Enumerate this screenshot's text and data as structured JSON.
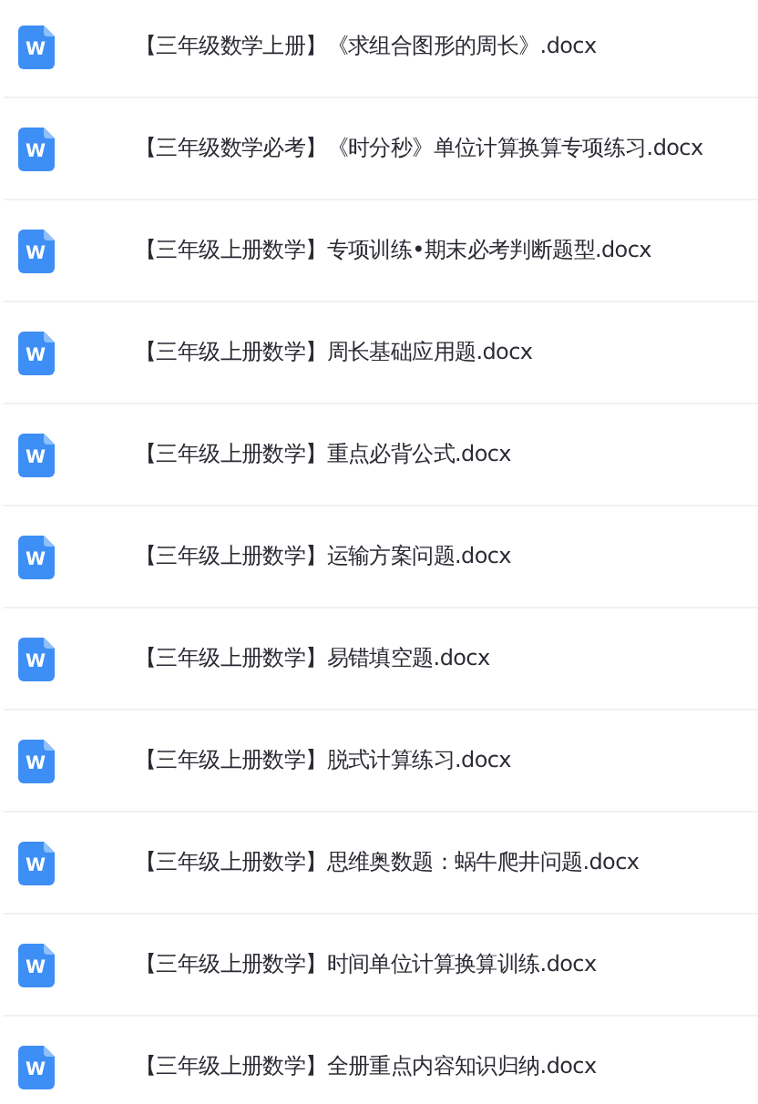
{
  "files": [
    {
      "icon_label": "W",
      "name": "【三年级数学上册】《求组合图形的周长》.docx"
    },
    {
      "icon_label": "W",
      "name": "【三年级数学必考】《时分秒》单位计算换算专项练习.docx"
    },
    {
      "icon_label": "W",
      "name": "【三年级上册数学】专项训练•期末必考判断题型.docx"
    },
    {
      "icon_label": "W",
      "name": "【三年级上册数学】周长基础应用题.docx"
    },
    {
      "icon_label": "W",
      "name": "【三年级上册数学】重点必背公式.docx"
    },
    {
      "icon_label": "W",
      "name": "【三年级上册数学】运输方案问题.docx"
    },
    {
      "icon_label": "W",
      "name": "【三年级上册数学】易错填空题.docx"
    },
    {
      "icon_label": "W",
      "name": "【三年级上册数学】脱式计算练习.docx"
    },
    {
      "icon_label": "W",
      "name": "【三年级上册数学】思维奥数题：蜗牛爬井问题.docx"
    },
    {
      "icon_label": "W",
      "name": "【三年级上册数学】时间单位计算换算训练.docx"
    },
    {
      "icon_label": "W",
      "name": "【三年级上册数学】全册重点内容知识归纳.docx"
    }
  ]
}
